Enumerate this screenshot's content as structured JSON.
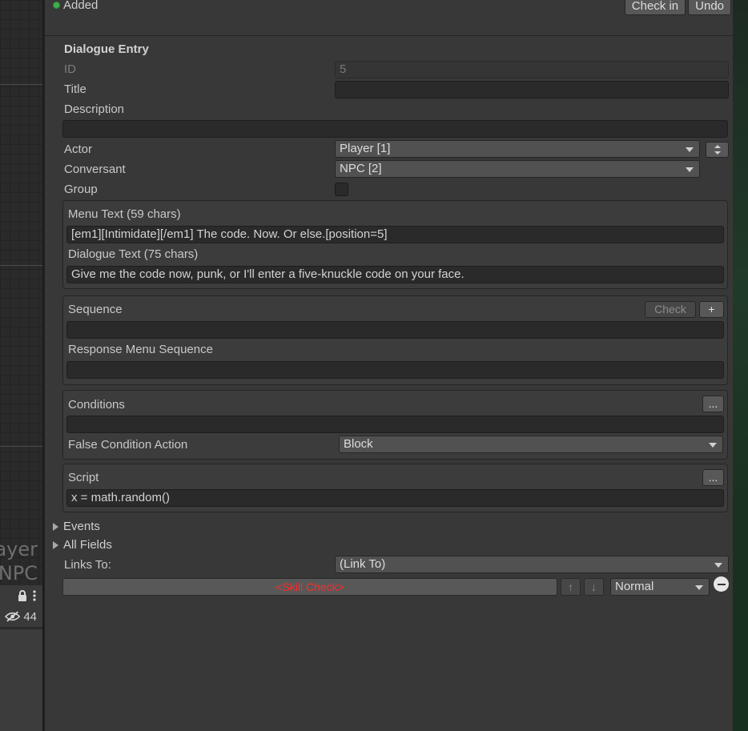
{
  "topbar": {
    "added_label": "Added",
    "checkin_label": "Check in",
    "undo_label": "Undo"
  },
  "left_pane": {
    "node_line1": "ayer",
    "node_line2": "NPC",
    "hidden_count": "44"
  },
  "entry": {
    "heading": "Dialogue Entry",
    "id_label": "ID",
    "id_value": "5",
    "title_label": "Title",
    "title_value": "",
    "description_label": "Description",
    "description_value": "",
    "actor_label": "Actor",
    "actor_value": "Player [1]",
    "conversant_label": "Conversant",
    "conversant_value": "NPC [2]",
    "group_label": "Group",
    "group_checked": false
  },
  "text": {
    "menu_label": "Menu Text (59 chars)",
    "menu_value": "[em1][Intimidate][/em1] The code. Now. Or else.[position=5]",
    "dialogue_label": "Dialogue Text (75 chars)",
    "dialogue_value": "Give me the code now, punk, or I'll enter a five-knuckle code on your face."
  },
  "sequence": {
    "label": "Sequence",
    "check_label": "Check",
    "add_label": "+",
    "value": "",
    "response_label": "Response Menu Sequence",
    "response_value": ""
  },
  "conditions": {
    "label": "Conditions",
    "more_label": "...",
    "value": "",
    "false_action_label": "False Condition Action",
    "false_action_value": "Block"
  },
  "script": {
    "label": "Script",
    "more_label": "...",
    "value": "x = math.random()"
  },
  "foldouts": {
    "events": "Events",
    "all_fields": "All Fields"
  },
  "links": {
    "label": "Links To:",
    "value": "(Link To)",
    "skill_check": "<Skill Check>",
    "up": "↑",
    "down": "↓",
    "priority": "Normal"
  }
}
